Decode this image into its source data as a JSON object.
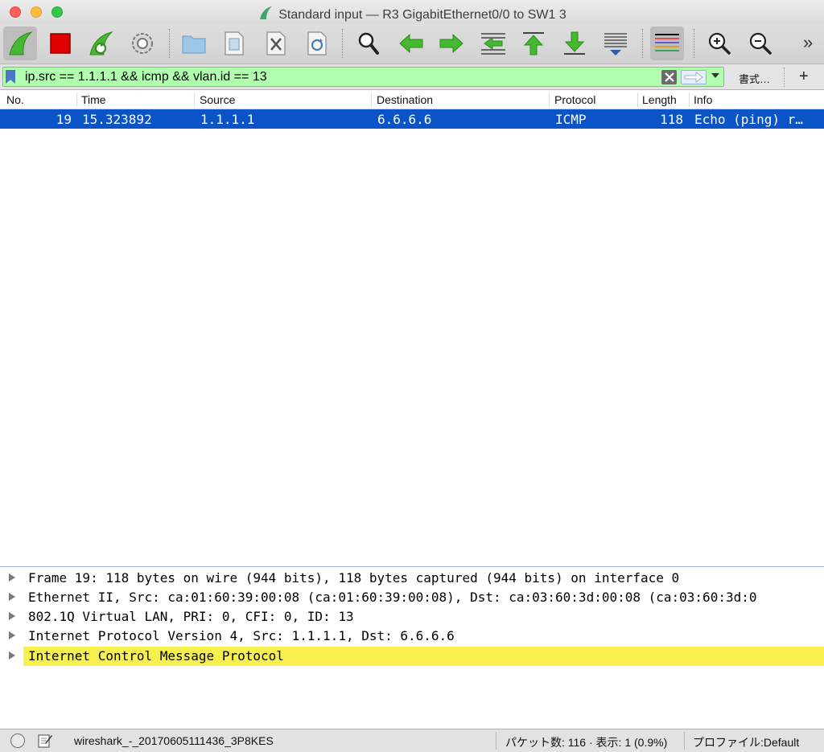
{
  "window": {
    "title": "Standard input — R3 GigabitEthernet0/0 to SW1 3"
  },
  "toolbar": {
    "icons": [
      "shark-fin-start-icon",
      "stop-square-icon",
      "restart-fin-icon",
      "capture-options-gear-icon",
      "open-folder-icon",
      "save-file-icon",
      "close-file-icon",
      "reload-file-icon",
      "find-magnifier-icon",
      "go-back-arrow-icon",
      "go-forward-arrow-icon",
      "go-to-packet-icon",
      "go-first-packet-icon",
      "go-last-packet-icon",
      "auto-scroll-icon",
      "colorize-icon",
      "zoom-in-icon",
      "zoom-out-icon"
    ],
    "more": "»",
    "colors": {
      "green": "#44b82e",
      "red": "#e00000"
    }
  },
  "filter": {
    "value": "ip.src == 1.1.1.1 && icmp && vlan.id == 13",
    "expression_button": "書式…",
    "add_button": "+",
    "background": "#afffaf"
  },
  "packet_list": {
    "columns": [
      "No.",
      "Time",
      "Source",
      "Destination",
      "Protocol",
      "Length",
      "Info"
    ],
    "rows": [
      {
        "no": "19",
        "time": "15.323892",
        "source": "1.1.1.1",
        "destination": "6.6.6.6",
        "protocol": "ICMP",
        "length": "118",
        "info": "Echo (ping) r…"
      }
    ],
    "selected_color": "#0b54c8"
  },
  "details": {
    "items": [
      "Frame 19: 118 bytes on wire (944 bits), 118 bytes captured (944 bits) on interface 0",
      "Ethernet II, Src: ca:01:60:39:00:08 (ca:01:60:39:00:08), Dst: ca:03:60:3d:00:08 (ca:03:60:3d:0",
      "802.1Q Virtual LAN, PRI: 0, CFI: 0, ID: 13",
      "Internet Protocol Version 4, Src: 1.1.1.1, Dst: 6.6.6.6",
      "Internet Control Message Protocol"
    ],
    "highlight_color": "#f8f04f"
  },
  "status": {
    "file": "wireshark_-_20170605111436_3P8KES",
    "packets": "パケット数: 116 · 表示: 1 (0.9%)",
    "profile": "プロファイル:Default"
  }
}
